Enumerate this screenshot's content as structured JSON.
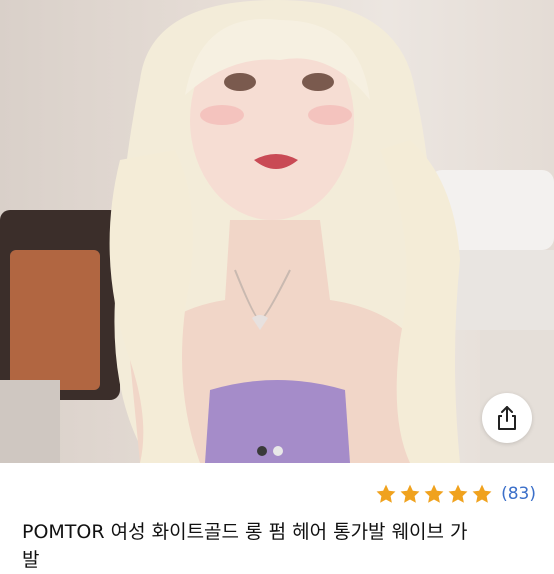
{
  "product": {
    "title_line1": "POMTOR 여성 화이트골드 롱 펌 헤어 통가발 웨이브 가",
    "title_line2": "발",
    "rating": {
      "stars": 5,
      "count_label": "(83)"
    }
  },
  "carousel": {
    "total": 2,
    "active_index": 0
  },
  "colors": {
    "star": "#f0a21e",
    "link": "#3b6fc9"
  },
  "icons": {
    "share": "share-icon",
    "star": "star-icon"
  }
}
